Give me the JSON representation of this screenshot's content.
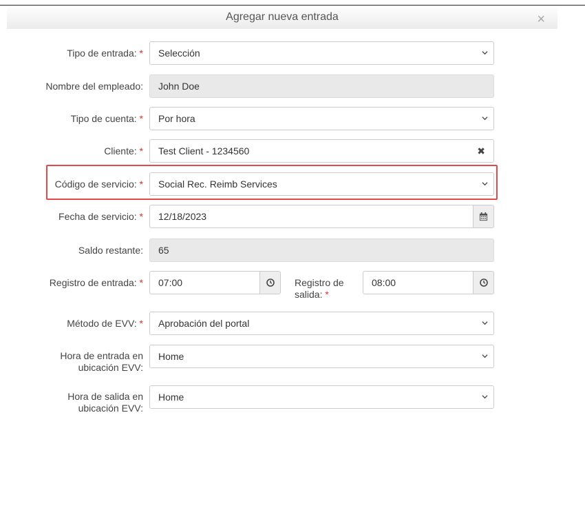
{
  "dialog": {
    "title": "Agregar nueva entrada",
    "close_symbol": "×"
  },
  "required_mark": "*",
  "fields": {
    "entry_type": {
      "label": "Tipo de entrada:",
      "value": "Selección"
    },
    "employee_name": {
      "label": "Nombre del empleado:",
      "value": "John Doe"
    },
    "account_type": {
      "label": "Tipo de cuenta:",
      "value": "Por hora"
    },
    "client": {
      "label": "Cliente:",
      "value": "Test Client - 1234560",
      "clear_symbol": "✖"
    },
    "service_code": {
      "label": "Código de servicio:",
      "value": "Social Rec. Reimb Services"
    },
    "service_date": {
      "label": "Fecha de servicio:",
      "value": "12/18/2023"
    },
    "remaining_balance": {
      "label": "Saldo restante:",
      "value": "65"
    },
    "check_in": {
      "label": "Registro de entrada:",
      "value": "07:00"
    },
    "check_out": {
      "label_line1": "Registro de",
      "label_line2": "salida:",
      "value": "08:00"
    },
    "evv_method": {
      "label": "Método de EVV:",
      "value": "Aprobación del portal"
    },
    "evv_in_location": {
      "label_line1": "Hora de entrada en",
      "label_line2": "ubicación EVV:",
      "value": "Home"
    },
    "evv_out_location": {
      "label_line1": "Hora de salida en",
      "label_line2": "ubicación EVV:",
      "value": "Home"
    }
  },
  "icons": {
    "dropdown": "chevron-down-icon",
    "calendar": "calendar-icon",
    "clock": "clock-icon",
    "clear": "clear-x-icon"
  },
  "colors": {
    "required": "#e0322b",
    "highlight_border": "#e04a4a"
  }
}
